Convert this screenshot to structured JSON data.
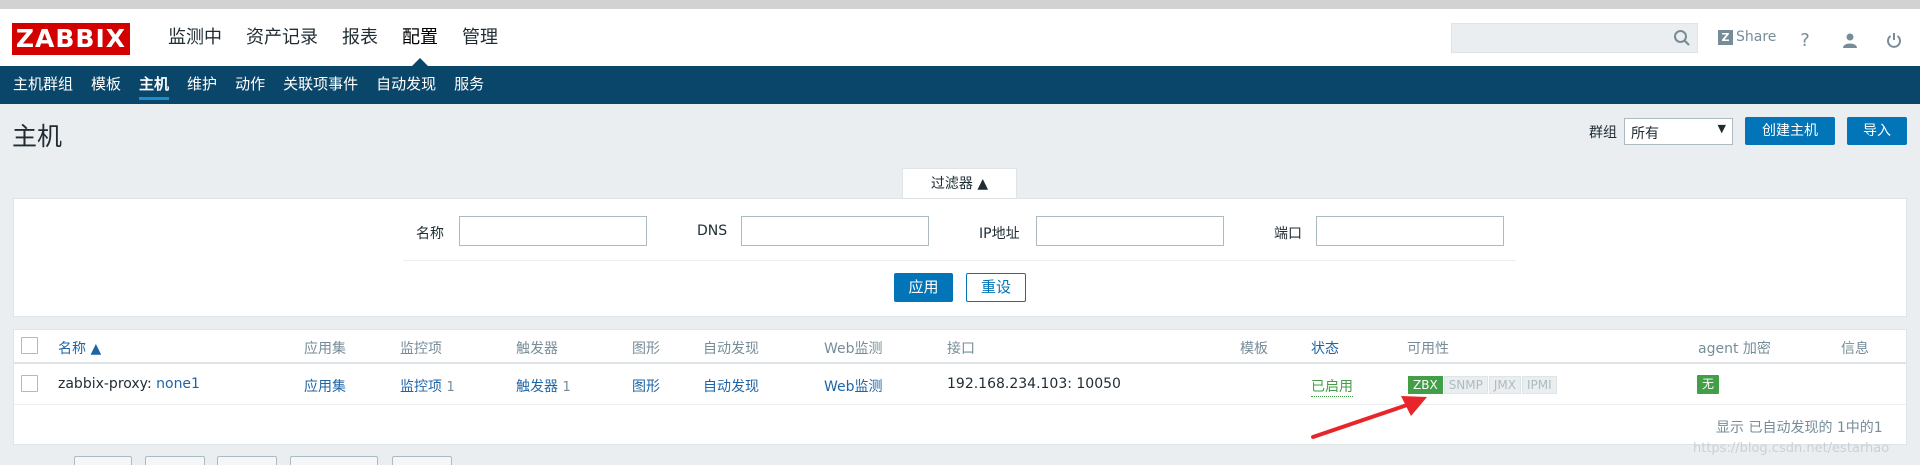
{
  "header": {
    "logo": "ZABBIX",
    "main_menu": [
      "监测中",
      "资产记录",
      "报表",
      "配置",
      "管理"
    ],
    "active_main": "配置",
    "search_placeholder": "",
    "share_label": "Share",
    "help": "?"
  },
  "subnav": {
    "items": [
      "主机群组",
      "模板",
      "主机",
      "维护",
      "动作",
      "关联项事件",
      "自动发现",
      "服务"
    ],
    "active": "主机"
  },
  "page": {
    "title": "主机",
    "group_label": "群组",
    "group_value": "所有",
    "create_button": "创建主机",
    "import_button": "导入"
  },
  "filter": {
    "tab_label": "过滤器 ▲",
    "fields": {
      "name_label": "名称",
      "dns_label": "DNS",
      "ip_label": "IP地址",
      "port_label": "端口"
    },
    "apply_button": "应用",
    "reset_button": "重设"
  },
  "table": {
    "columns": [
      "名称 ▲",
      "应用集",
      "监控项",
      "触发器",
      "图形",
      "自动发现",
      "Web监测",
      "接口",
      "模板",
      "状态",
      "可用性",
      "agent 加密",
      "信息"
    ],
    "rows": [
      {
        "name_prefix": "zabbix-proxy: ",
        "name_link": "none1",
        "applications": "应用集",
        "items": "监控项",
        "items_count": "1",
        "triggers": "触发器",
        "triggers_count": "1",
        "graphs": "图形",
        "discovery": "自动发现",
        "web": "Web监测",
        "interface": "192.168.234.103: 10050",
        "templates": "",
        "status": "已启用",
        "availability": [
          "ZBX",
          "SNMP",
          "JMX",
          "IPMI"
        ],
        "encryption": "无",
        "info": ""
      }
    ],
    "footer": "显示 已自动发现的 1中的1"
  },
  "watermark": "https://blog.csdn.net/estarhao",
  "colors": {
    "brand_red": "#d40000",
    "nav_blue": "#0a466a",
    "button_blue": "#0275b8",
    "status_green": "#429e47",
    "annotation_red": "#e8252a"
  }
}
